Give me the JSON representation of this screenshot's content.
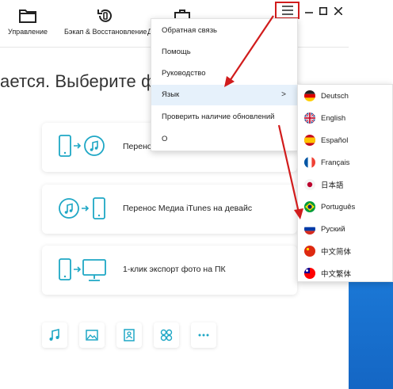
{
  "toolbar": {
    "items": [
      {
        "label": "Управление",
        "icon": "folder-icon"
      },
      {
        "label": "Бэкап & Восстановление",
        "icon": "backup-restore-icon"
      },
      {
        "label": "Д",
        "icon": "toolbox-icon"
      }
    ],
    "menu_icon": "hamburger-menu-icon",
    "window_controls": [
      "minimize-icon",
      "maximize-icon",
      "close-icon"
    ]
  },
  "main": {
    "headline": "ается. Выберите функц",
    "cards": [
      {
        "label": "Перенос медиафайлов в iTunes",
        "icon_left": "device-icon",
        "icon_right": "itunes-icon"
      },
      {
        "label": "Перенос Медиа iTunes на девайс",
        "icon_left": "itunes-icon",
        "icon_right": "device-icon"
      },
      {
        "label": "1-клик экспорт фото на ПК",
        "icon_left": "device-icon",
        "icon_right": "monitor-icon"
      }
    ],
    "bottom_icons": [
      "music-icon",
      "photo-icon",
      "contacts-icon",
      "apps-icon",
      "more-icon"
    ]
  },
  "menu": {
    "items": [
      {
        "label": "Обратная связь"
      },
      {
        "label": "Помощь"
      },
      {
        "label": "Руководство"
      },
      {
        "label": "Язык",
        "submenu": true,
        "chevron": ">"
      },
      {
        "label": "Проверить наличие обновлений"
      },
      {
        "label": "О"
      }
    ]
  },
  "languages": [
    {
      "label": "Deutsch",
      "flag": "flag-germany"
    },
    {
      "label": "English",
      "flag": "flag-uk"
    },
    {
      "label": "Español",
      "flag": "flag-spain"
    },
    {
      "label": "Français",
      "flag": "flag-france"
    },
    {
      "label": "日本語",
      "flag": "flag-japan"
    },
    {
      "label": "Português",
      "flag": "flag-brazil"
    },
    {
      "label": "Руский",
      "flag": "flag-russia"
    },
    {
      "label": "中文简体",
      "flag": "flag-china"
    },
    {
      "label": "中文繁体",
      "flag": "flag-taiwan"
    }
  ],
  "colors": {
    "accent": "#1ea7c5",
    "annotation": "#d11c1c",
    "highlight": "#e6f1fb",
    "desktop_blue": "#1466c4"
  }
}
